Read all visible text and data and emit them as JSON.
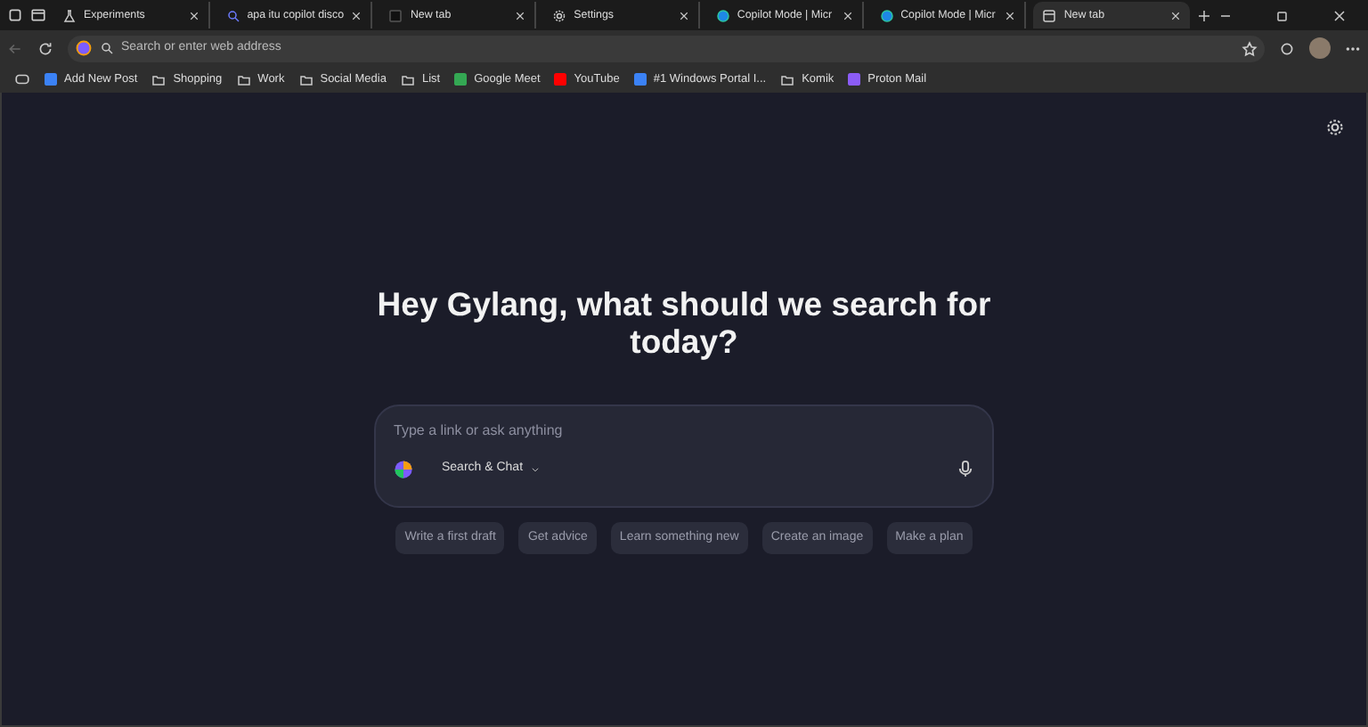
{
  "tabs": [
    {
      "label": "Experiments",
      "kind": "flask",
      "selected": false
    },
    {
      "label": "apa itu copilot disco",
      "kind": "search",
      "selected": false
    },
    {
      "label": "New tab",
      "kind": "page",
      "selected": false
    },
    {
      "label": "Settings",
      "kind": "gear",
      "selected": false
    },
    {
      "label": "Copilot Mode | Micr",
      "kind": "edge",
      "selected": false
    },
    {
      "label": "Copilot Mode | Micr",
      "kind": "edge",
      "selected": false
    },
    {
      "label": "New tab",
      "kind": "newtab",
      "selected": true
    }
  ],
  "address": {
    "placeholder": "Search or enter web address"
  },
  "bookmarks": [
    {
      "label": "Add New Post",
      "kind": "site",
      "color": "#3b82f6"
    },
    {
      "label": "Shopping",
      "kind": "folder"
    },
    {
      "label": "Work",
      "kind": "folder"
    },
    {
      "label": "Social Media",
      "kind": "folder"
    },
    {
      "label": "List",
      "kind": "folder"
    },
    {
      "label": "Google Meet",
      "kind": "site",
      "color": "#34a853"
    },
    {
      "label": "YouTube",
      "kind": "site",
      "color": "#ff0000"
    },
    {
      "label": "#1 Windows Portal I...",
      "kind": "site",
      "color": "#3b82f6"
    },
    {
      "label": "Komik",
      "kind": "folder"
    },
    {
      "label": "Proton Mail",
      "kind": "site",
      "color": "#8b5cf6"
    }
  ],
  "main": {
    "heading": "Hey Gylang, what should we search for today?",
    "prompt": {
      "placeholder": "Type a link or ask anything",
      "mode": "Search & Chat"
    },
    "suggestions": [
      "Write a first draft",
      "Get advice",
      "Learn something new",
      "Create an image",
      "Make a plan"
    ]
  }
}
